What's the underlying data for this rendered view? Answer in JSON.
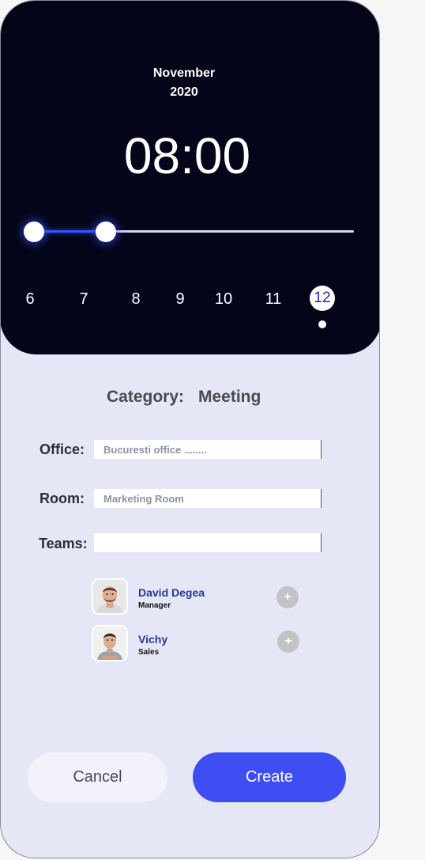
{
  "header": {
    "month": "November",
    "year": "2020",
    "time": "08:00",
    "hours": [
      "6",
      "7",
      "8",
      "9",
      "10",
      "11",
      "12"
    ],
    "selected_hour": "12"
  },
  "form": {
    "category_label": "Category:",
    "category_value": "Meeting",
    "office_label": "Office:",
    "office_value": "Bucuresti office ........",
    "room_label": "Room:",
    "room_value": "Marketing Room",
    "teams_label": "Teams:",
    "teams_value": ""
  },
  "members": [
    {
      "name": "David Degea",
      "role": "Manager",
      "add_icon": "+"
    },
    {
      "name": "Vichy",
      "role": "Sales",
      "add_icon": "+"
    }
  ],
  "actions": {
    "cancel_label": "Cancel",
    "create_label": "Create"
  },
  "colors": {
    "header_bg": "#05051a",
    "accent": "#3f4ef2",
    "panel_bg": "#e5e7f6"
  }
}
